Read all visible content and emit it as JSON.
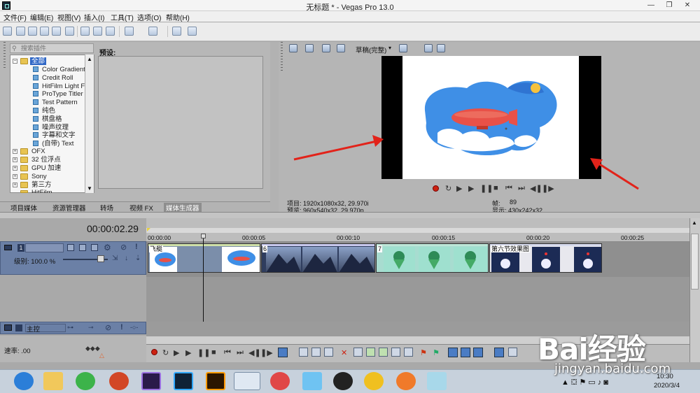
{
  "window": {
    "title": "无标题 * - Vegas Pro 13.0",
    "min": "—",
    "max": "❐",
    "close": "✕"
  },
  "menu": [
    "文件(F)",
    "编辑(E)",
    "视图(V)",
    "插入(I)",
    "工具(T)",
    "选项(O)",
    "帮助(H)"
  ],
  "plugins": {
    "search_placeholder": "搜索插件",
    "tree": [
      "全部",
      "Color Gradient",
      "Credit Roll",
      "HitFilm Light Fla",
      "ProType Titler",
      "Test Pattern",
      "纯色",
      "棋盘格",
      "噪声纹理",
      "字幕和文字",
      "(自带) Text",
      "OFX",
      "32 位浮点",
      "GPU 加速",
      "Sony",
      "第三方",
      "HitFilm"
    ],
    "preset_label": "预设:"
  },
  "left_tabs": [
    "项目媒体",
    "资源管理器",
    "转场",
    "视频 FX",
    "媒体生成器"
  ],
  "preview": {
    "quality": "草稿(完整)",
    "project_label": "项目: 1920x1080x32, 29.970i",
    "preview_label": "预览: 960x540x32, 29.970p",
    "frame_label": "帧:",
    "frame_value": "89",
    "display_label": "显示: 430x242x32"
  },
  "timeline": {
    "time": "00:00:02.29",
    "ruler": [
      "00:00:00",
      "00:00:05",
      "00:00:10",
      "00:00:15",
      "00:00:20",
      "00:00:25"
    ],
    "track_number": "1",
    "level": "级别: 100.0 %",
    "master": "主控",
    "rate": "速率: .00",
    "clips": [
      {
        "label": "飞艇",
        "color": "#cfe0a8"
      },
      {
        "label": "6",
        "color": "#c8c8ee"
      },
      {
        "label": "7",
        "color": "#bde7d8"
      },
      {
        "label": "第六节效果图",
        "color": "#d7dbee"
      }
    ]
  },
  "taskbar": {
    "time": "10:30",
    "date": "2020/3/4"
  },
  "watermark": {
    "text": "Bai经验",
    "url": "jingyan.baidu.com"
  }
}
